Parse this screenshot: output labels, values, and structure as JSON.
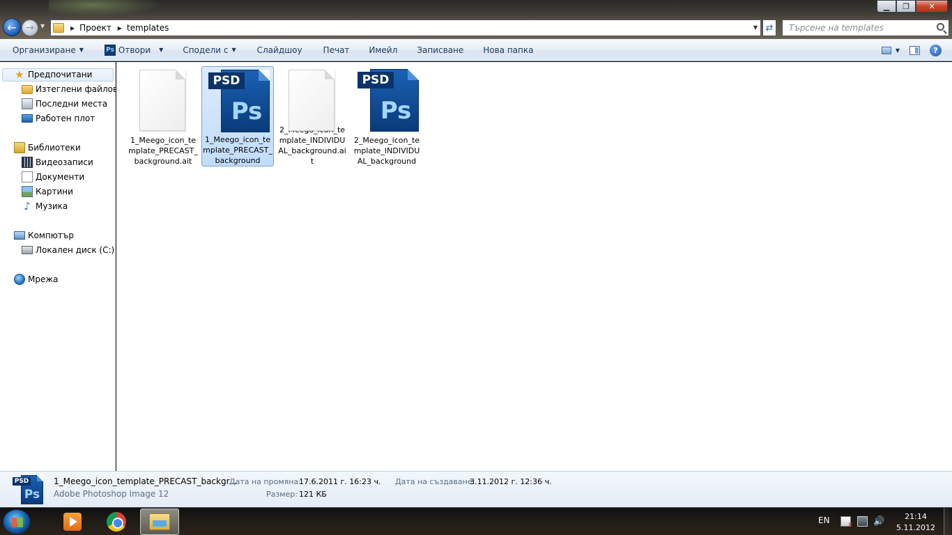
{
  "window": {
    "min_glyph": "▁",
    "max_glyph": "❐",
    "close_glyph": "✕"
  },
  "address": {
    "crumbs": [
      "Проект",
      "templates"
    ],
    "refresh_glyph": "⇄",
    "back_glyph": "←",
    "forward_glyph": "→"
  },
  "search": {
    "placeholder": "Търсене на templates"
  },
  "toolbar": {
    "organize": "Организиране",
    "open": "Отвори",
    "share": "Сподели с",
    "slideshow": "Слайдшоу",
    "print": "Печат",
    "email": "Имейл",
    "burn": "Записване",
    "new_folder": "Нова папка",
    "open_app_icon": "Ps",
    "help_glyph": "?"
  },
  "nav": {
    "favorites": "Предпочитани",
    "downloads": "Изтеглени файлове",
    "recent": "Последни места",
    "desktop": "Работен плот",
    "libraries": "Библиотеки",
    "videos": "Видеозаписи",
    "documents": "Документи",
    "pictures": "Картини",
    "music": "Музика",
    "computer": "Компютър",
    "local_disk": "Локален диск (C:)",
    "network": "Мрежа"
  },
  "files": [
    {
      "name": "1_Meego_icon_template_PRECAST_background.ait",
      "icon": "blank-document-icon",
      "selected": false
    },
    {
      "name": "1_Meego_icon_template_PRECAST_background",
      "icon": "psd-file-icon",
      "selected": true
    },
    {
      "name": "2_Meego_icon_template_INDIVIDUAL_background.ait",
      "icon": "blank-document-icon",
      "selected": false
    },
    {
      "name": "2_Meego_icon_template_INDIVIDUAL_background",
      "icon": "psd-file-icon",
      "selected": false
    }
  ],
  "psd_icon": {
    "tag": "PSD",
    "letters": "Ps"
  },
  "details": {
    "name": "1_Meego_icon_template_PRECAST_backgr...",
    "type": "Adobe Photoshop Image 12",
    "modified_label": "Дата на промяна:",
    "modified_value": "17.6.2011 г. 16:23 ч.",
    "created_label": "Дата на създаване:",
    "created_value": "3.11.2012 г. 12:36 ч.",
    "size_label": "Размер:",
    "size_value": "121 КБ"
  },
  "taskbar": {
    "language": "EN",
    "time": "21:14",
    "date": "5.11.2012 г.",
    "volume_glyph": "🔊"
  },
  "colors": {
    "selection_bg": "#c1dcfc",
    "selection_border": "#7da2ce",
    "command_text": "#1e395b",
    "psd_blue": "#0a3b7a"
  }
}
